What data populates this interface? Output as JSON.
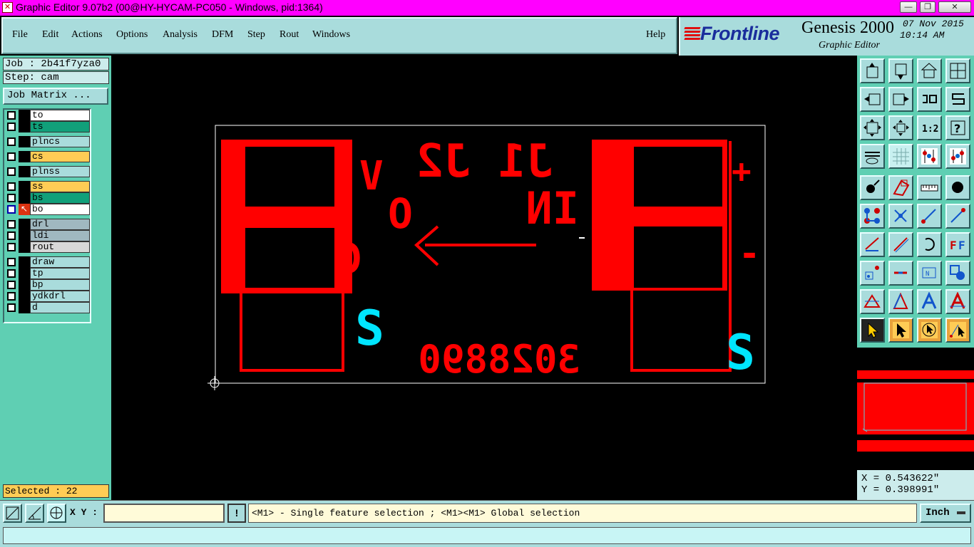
{
  "titlebar": {
    "title": "Graphic Editor 9.07b2 (00@HY-HYCAM-PC050 - Windows, pid:1364)",
    "minimize": "—",
    "restore": "❐",
    "close": "✕"
  },
  "menu": {
    "items": [
      {
        "label": "File"
      },
      {
        "label": "Edit"
      },
      {
        "label": "Actions"
      },
      {
        "label": "Options"
      },
      {
        "label": "Analysis"
      },
      {
        "label": "DFM"
      },
      {
        "label": "Step"
      },
      {
        "label": "Rout"
      },
      {
        "label": "Windows"
      },
      {
        "label": "Help"
      }
    ]
  },
  "logo": {
    "brand": "Frontline",
    "product": "Genesis 2000",
    "subtitle": "Graphic Editor",
    "date": "07 Nov 2015",
    "time": "10:14 AM"
  },
  "left": {
    "job": "Job : 2b41f7yza0",
    "step": "Step: cam",
    "job_matrix": "Job Matrix ...",
    "layers": [
      {
        "name": "to",
        "color": "#ffffff"
      },
      {
        "name": "ts",
        "color": "#11a07a"
      },
      {
        "name": "plncs",
        "color": "#a9dcdc"
      },
      {
        "name": "cs",
        "color": "#ffcc55"
      },
      {
        "name": "plnss",
        "color": "#a9dcdc"
      },
      {
        "name": "ss",
        "color": "#ffcc55"
      },
      {
        "name": "bs",
        "color": "#11a07a"
      },
      {
        "name": "bo",
        "color": "#ffffff",
        "active": true
      },
      {
        "name": "drl",
        "color": "#a0b8c0"
      },
      {
        "name": "ldi",
        "color": "#a0b8c0"
      },
      {
        "name": "rout",
        "color": "#d8d8d8"
      },
      {
        "name": "draw",
        "color": "#a9dcdc"
      },
      {
        "name": "tp",
        "color": "#a9dcdc"
      },
      {
        "name": "bp",
        "color": "#a9dcdc"
      },
      {
        "name": "ydkdrl",
        "color": "#a9dcdc"
      },
      {
        "name": "d",
        "color": "#a9dcdc"
      }
    ],
    "selected": "Selected : 22"
  },
  "board": {
    "text_top": "J1 J2",
    "text_v": "V",
    "text_o": "O",
    "text_g": "G",
    "text_in": "IN",
    "text_number": "3028890",
    "text_s": "S",
    "plus": "+",
    "minus": "-",
    "colors": {
      "copper": "#ff0000",
      "silk": "#00e5ff",
      "outline": "#ffffff"
    }
  },
  "tools": {
    "rows": [
      [
        "arrow-up-icon",
        "arrow-down-icon",
        "home-icon",
        "window-xy-icon"
      ],
      [
        "arrow-left-icon",
        "arrow-right-icon",
        "flip-icon",
        "text-s-icon"
      ],
      [
        "zoom-fit-icon",
        "zoom-center-icon",
        "scale-1-2-icon",
        "question-icon"
      ],
      [
        "palette-icon",
        "grid-icon",
        "layers-a-icon",
        "layers-b-icon"
      ],
      [
        "dot-arrow-icon",
        "polygon-icon",
        "ruler-icon",
        "pad-icon"
      ],
      [
        "connect-icon",
        "cross-icon",
        "line-dot-icon",
        "line-dot2-icon"
      ],
      [
        "angle-icon",
        "diag-line-icon",
        "arc-icon",
        "mirror-f-icon"
      ],
      [
        "move-icon",
        "minus-icon",
        "measure-icon",
        "square-dots-icon"
      ],
      [
        "triangle-icon",
        "triangle-a-icon",
        "letter-a-icon",
        "letter-a2-icon"
      ],
      [
        "pointer-icon",
        "pointer2-icon",
        "circle-pointer-icon",
        "snap-pointer-icon"
      ]
    ],
    "question_text": "?",
    "scale_text": "1:2"
  },
  "coords": {
    "x": "X = 0.543622\"",
    "y": "Y = 0.398991\""
  },
  "bottom": {
    "xy_label": "X Y :",
    "xy_value": "",
    "warn": "!",
    "status": "<M1> - Single feature selection ; <M1><M1> Global selection",
    "unit": "Inch"
  }
}
